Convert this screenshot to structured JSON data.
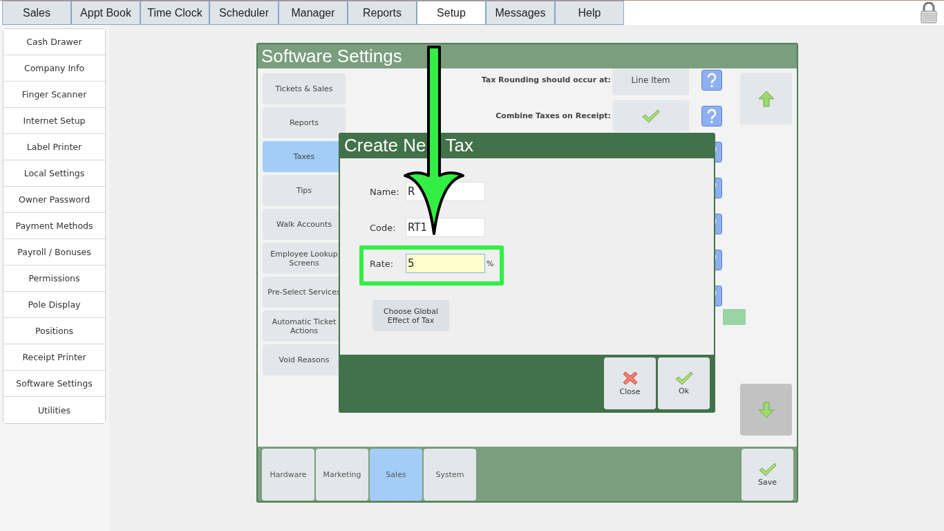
{
  "top_tabs": [
    {
      "label": "Sales",
      "selected": false
    },
    {
      "label": "Appt Book",
      "selected": false
    },
    {
      "label": "Time Clock",
      "selected": false
    },
    {
      "label": "Scheduler",
      "selected": false
    },
    {
      "label": "Manager",
      "selected": false
    },
    {
      "label": "Reports",
      "selected": false
    },
    {
      "label": "Setup",
      "selected": true
    },
    {
      "label": "Messages",
      "selected": false
    },
    {
      "label": "Help",
      "selected": false
    }
  ],
  "sidebar": {
    "items": [
      {
        "label": "Cash Drawer"
      },
      {
        "label": "Company Info"
      },
      {
        "label": "Finger Scanner"
      },
      {
        "label": "Internet Setup"
      },
      {
        "label": "Label Printer"
      },
      {
        "label": "Local Settings"
      },
      {
        "label": "Owner Password"
      },
      {
        "label": "Payment Methods"
      },
      {
        "label": "Payroll / Bonuses"
      },
      {
        "label": "Permissions"
      },
      {
        "label": "Pole Display"
      },
      {
        "label": "Positions"
      },
      {
        "label": "Receipt Printer"
      },
      {
        "label": "Software Settings"
      },
      {
        "label": "Utilities"
      }
    ]
  },
  "settings": {
    "title": "Software Settings",
    "sections": [
      {
        "label": "Tickets & Sales",
        "selected": false
      },
      {
        "label": "Reports",
        "selected": false
      },
      {
        "label": "Taxes",
        "selected": true
      },
      {
        "label": "Tips",
        "selected": false
      },
      {
        "label": "Walk Accounts",
        "selected": false
      },
      {
        "label": "Employee Lookup Screens",
        "selected": false
      },
      {
        "label": "Pre-Select Services",
        "selected": false
      },
      {
        "label": "Automatic Ticket Actions",
        "selected": false
      },
      {
        "label": "Void Reasons",
        "selected": false
      }
    ],
    "rows": [
      {
        "kind": "value",
        "label": "Tax Rounding should occur at:",
        "value": "Line Item"
      },
      {
        "kind": "check",
        "label": "Combine Taxes on Receipt:",
        "checked": true
      },
      {
        "kind": "covered"
      },
      {
        "kind": "covered"
      },
      {
        "kind": "covered"
      },
      {
        "kind": "covered"
      },
      {
        "kind": "covered"
      }
    ],
    "scroll": {
      "up_disabled": false,
      "down_disabled": true
    },
    "categories": [
      {
        "label": "Hardware",
        "selected": false
      },
      {
        "label": "Marketing",
        "selected": false
      },
      {
        "label": "Sales",
        "selected": true
      },
      {
        "label": "System",
        "selected": false
      }
    ],
    "save_button": "Save"
  },
  "dialog": {
    "title_parts": [
      "Create Ne",
      "Tax"
    ],
    "fields": [
      {
        "label": "Name:",
        "value": "R",
        "focused": false
      },
      {
        "label": "Code:",
        "value": "RT1",
        "focused": false
      },
      {
        "label": "Rate:",
        "value": "5",
        "suffix": "%",
        "focused": true
      }
    ],
    "effect_button": "Choose Global Effect of Tax",
    "buttons": [
      {
        "kind": "close",
        "label": "Close"
      },
      {
        "kind": "ok",
        "label": "Ok"
      }
    ]
  }
}
